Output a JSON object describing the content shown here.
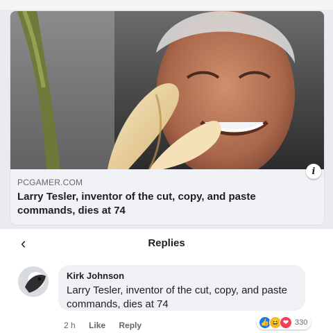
{
  "link_card": {
    "domain": "PCGAMER.COM",
    "headline": "Larry Tesler, inventor of the cut, copy, and paste commands, dies at 74",
    "info_icon": "i"
  },
  "replies_header": {
    "back_icon": "‹",
    "title": "Replies"
  },
  "comment": {
    "author": "Kirk Johnson",
    "text": "Larry Tesler, inventor of the cut, copy, and paste commands, dies at 74",
    "time": "2 h",
    "like_label": "Like",
    "reply_label": "Reply",
    "reaction_count": "330",
    "reaction_icons": [
      "like-icon",
      "haha-icon",
      "love-icon"
    ]
  },
  "colors": {
    "facebook_blue": "#1877f2",
    "haha_yellow": "#f7b928",
    "love_red": "#f33e58"
  }
}
